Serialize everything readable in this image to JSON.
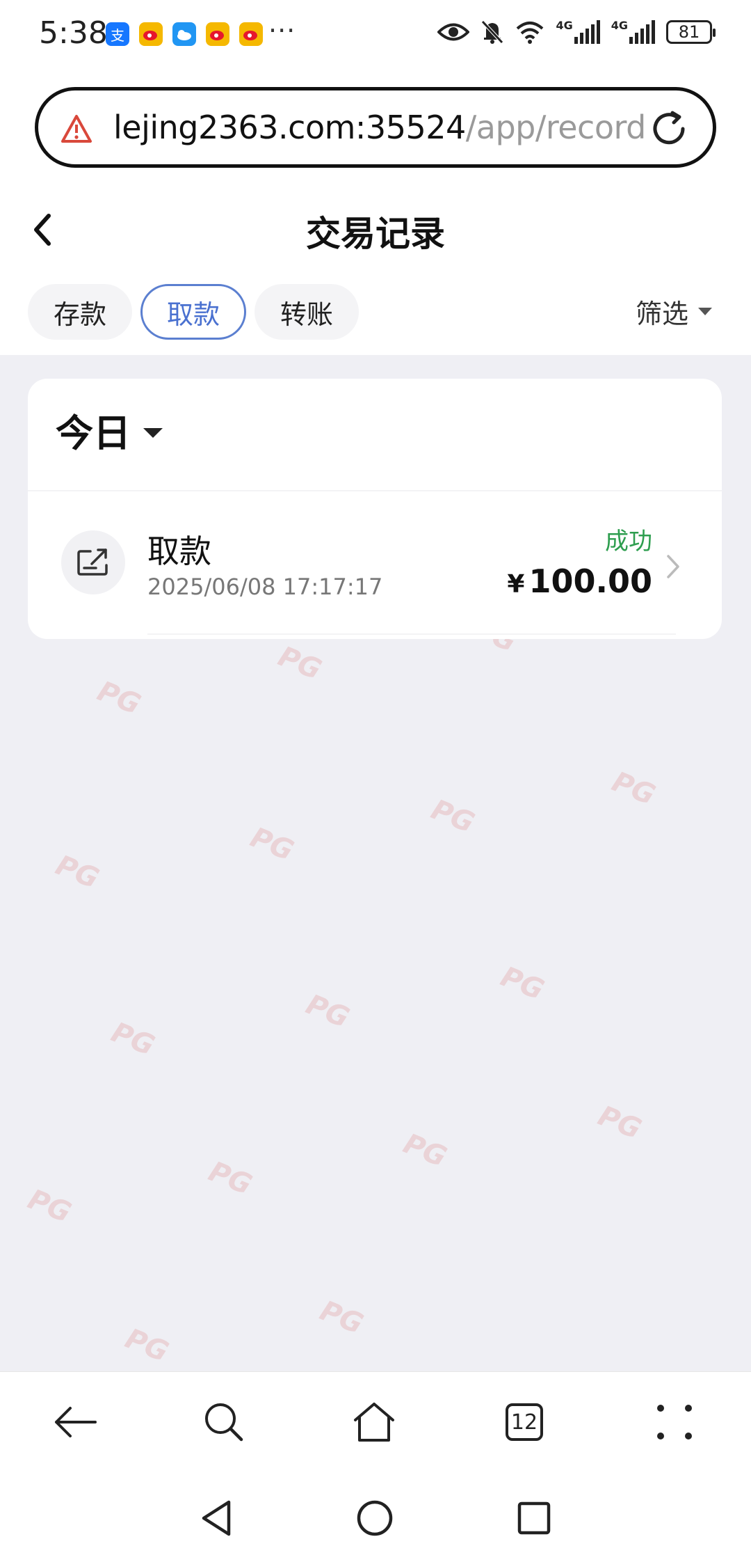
{
  "status_bar": {
    "time": "5:38",
    "app_icons": [
      "alipay-icon",
      "weibo-icon",
      "weather-icon",
      "weibo-icon",
      "weibo-icon"
    ],
    "more": "···",
    "network": [
      "4G",
      "4G"
    ],
    "battery": "81"
  },
  "browser": {
    "url_host": "lejing2363.com:35524",
    "url_path": "/app/record",
    "tabs_count": "12"
  },
  "page": {
    "title": "交易记录",
    "tabs": [
      {
        "label": "存款",
        "active": false
      },
      {
        "label": "取款",
        "active": true
      },
      {
        "label": "转账",
        "active": false
      }
    ],
    "filter_label": "筛选"
  },
  "records": {
    "group_label": "今日",
    "items": [
      {
        "type": "取款",
        "time": "2025/06/08 17:17:17",
        "status": "成功",
        "currency": "¥",
        "amount": "100.00"
      }
    ]
  },
  "colors": {
    "accent": "#4a71d0",
    "success": "#2e9e4f",
    "content_bg": "#efeff4"
  }
}
